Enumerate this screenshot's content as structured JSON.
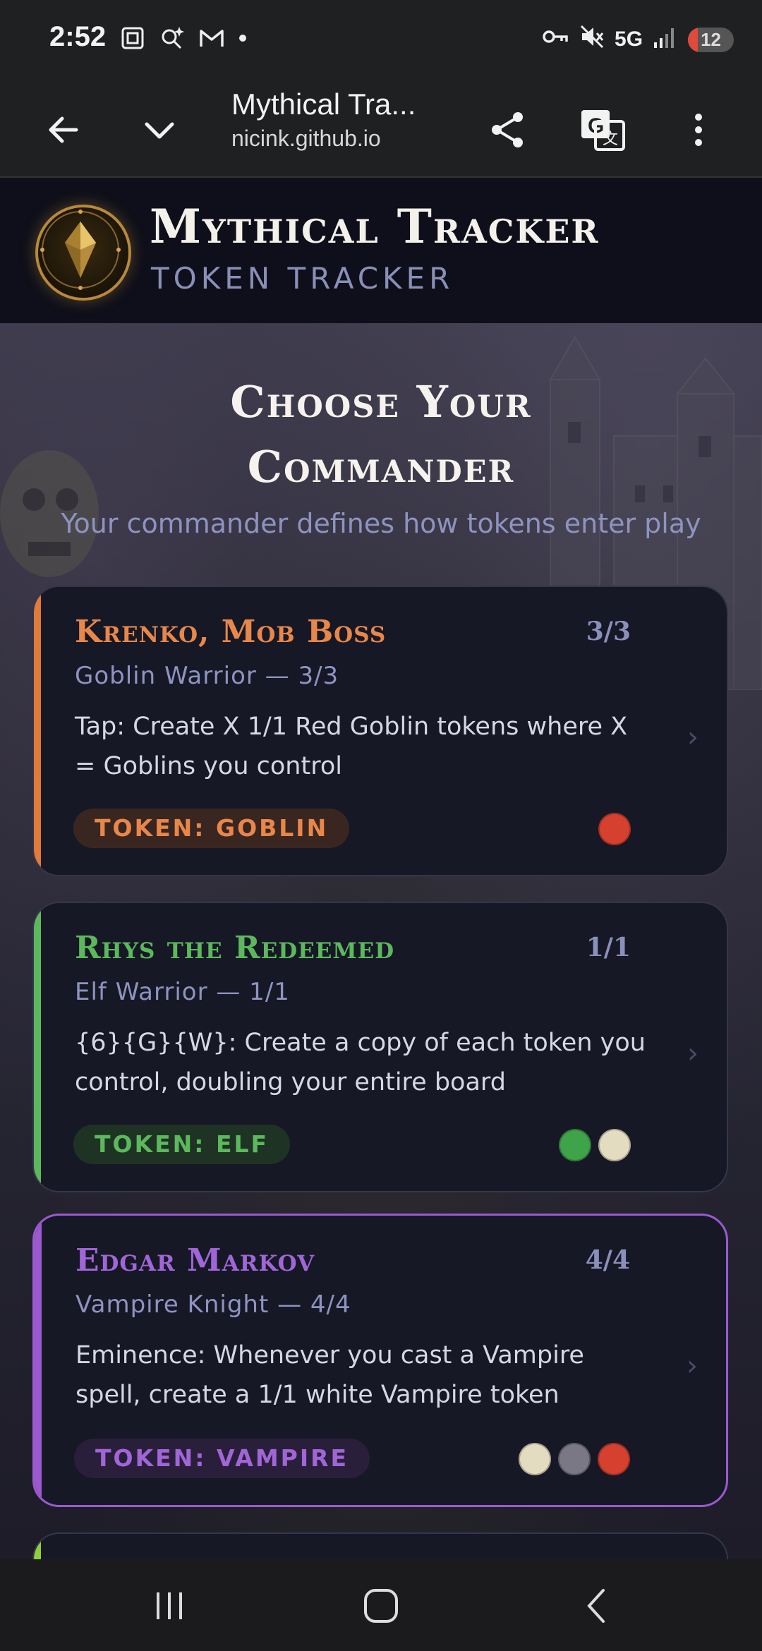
{
  "status_bar": {
    "time": "2:52",
    "network": "5G",
    "battery": "12"
  },
  "browser": {
    "page_title": "Mythical Tra...",
    "url": "nicink.github.io"
  },
  "site": {
    "brand_title": "Mythical Tracker",
    "brand_subtitle": "TOKEN TRACKER"
  },
  "main": {
    "heading_line1": "Choose Your",
    "heading_line2": "Commander",
    "subheading": "Your commander defines how tokens enter play"
  },
  "commanders": [
    {
      "name": "Krenko, Mob Boss",
      "pt": "3/3",
      "type": "Goblin Warrior — 3/3",
      "description": "Tap: Create X 1/1 Red Goblin tokens where X = Goblins you control",
      "badge": "TOKEN: GOBLIN",
      "accent": "#e07b3a",
      "colors": [
        "#d6402f"
      ]
    },
    {
      "name": "Rhys the Redeemed",
      "pt": "1/1",
      "type": "Elf Warrior — 1/1",
      "description": "{6}{G}{W}: Create a copy of each token you control, doubling your entire board",
      "badge": "TOKEN: ELF",
      "accent": "#5cb85c",
      "colors": [
        "#3fa34a",
        "#e4dcc0"
      ]
    },
    {
      "name": "Edgar Markov",
      "pt": "4/4",
      "type": "Vampire Knight — 4/4",
      "description": "Eminence: Whenever you cast a Vampire spell, create a 1/1 white Vampire token",
      "badge": "TOKEN: VAMPIRE",
      "accent": "#9b59d0",
      "colors": [
        "#e4dcc0",
        "#7a7884",
        "#d6402f"
      ]
    }
  ]
}
